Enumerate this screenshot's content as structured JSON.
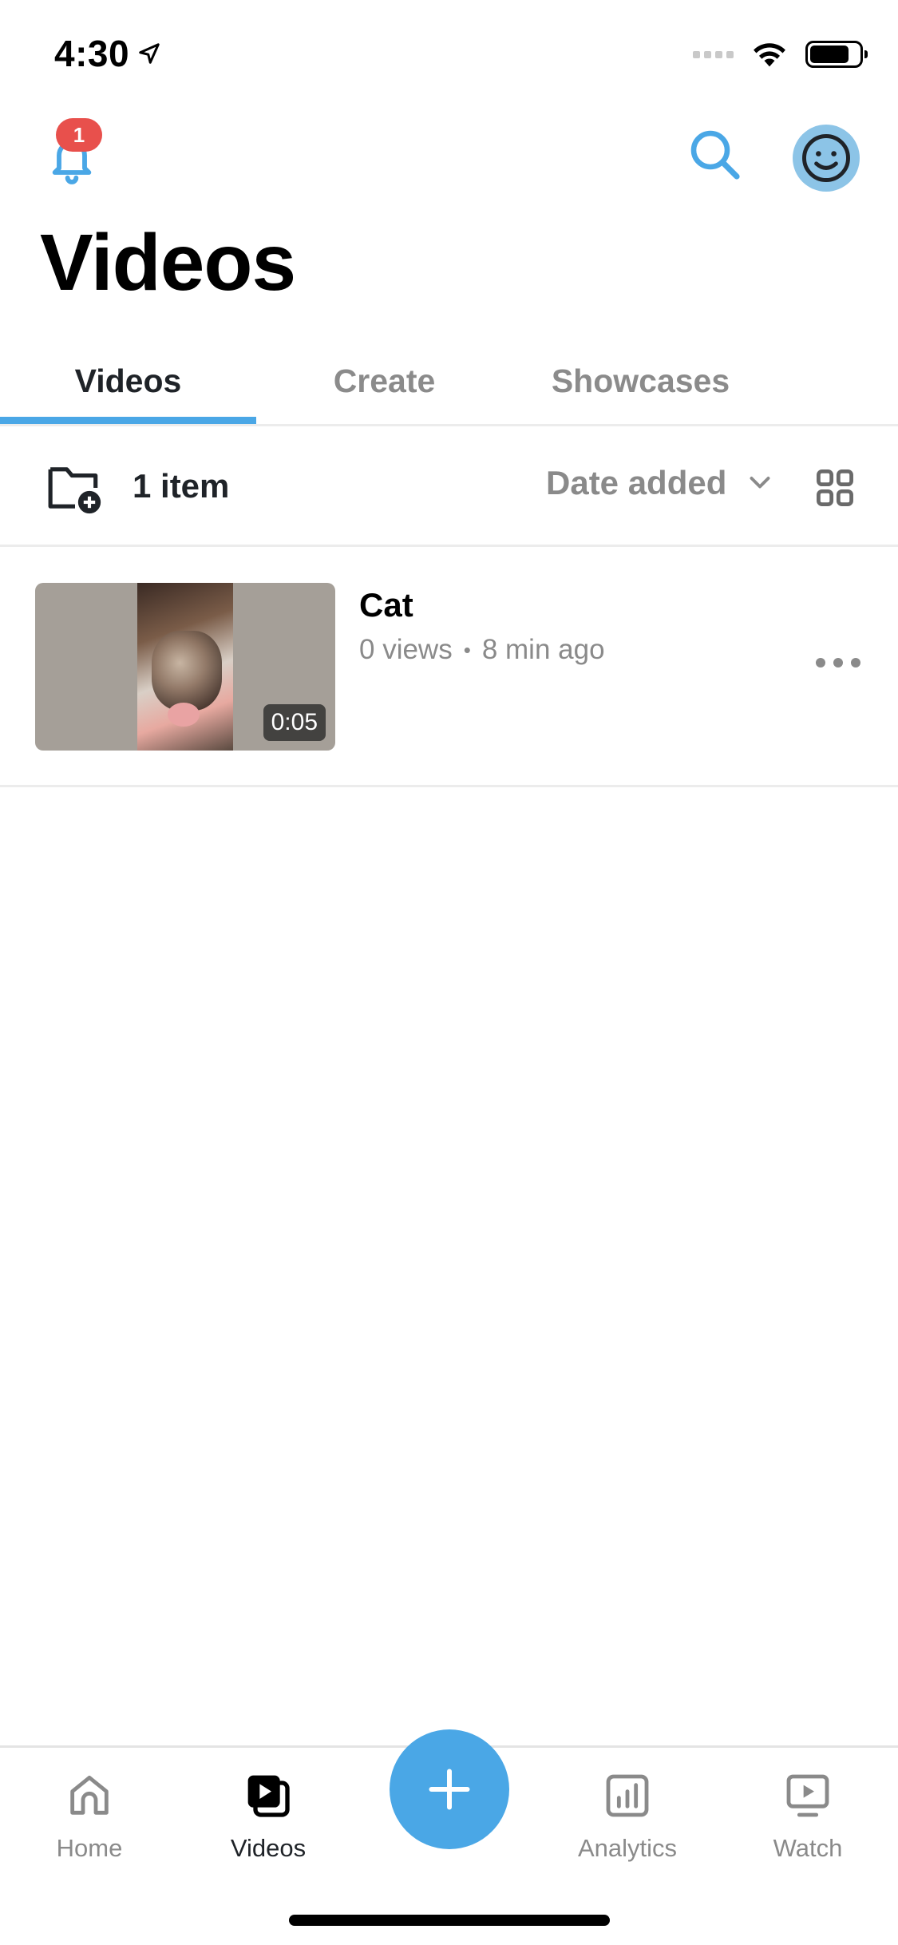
{
  "status_bar": {
    "time": "4:30"
  },
  "header": {
    "notification_count": "1",
    "title": "Videos"
  },
  "tabs": [
    {
      "label": "Videos",
      "active": true
    },
    {
      "label": "Create",
      "active": false
    },
    {
      "label": "Showcases",
      "active": false
    }
  ],
  "toolbar": {
    "item_count": "1 item",
    "sort_label": "Date added"
  },
  "videos": [
    {
      "title": "Cat",
      "views": "0 views",
      "age": "8 min ago",
      "duration": "0:05"
    }
  ],
  "bottom_nav": [
    {
      "label": "Home",
      "icon": "home-icon",
      "active": false
    },
    {
      "label": "Videos",
      "icon": "videos-icon",
      "active": true
    },
    {
      "label": "Analytics",
      "icon": "analytics-icon",
      "active": false
    },
    {
      "label": "Watch",
      "icon": "watch-icon",
      "active": false
    }
  ],
  "colors": {
    "accent": "#4aa7e6",
    "badge": "#e8504c",
    "muted_text": "#8a8a8a"
  }
}
